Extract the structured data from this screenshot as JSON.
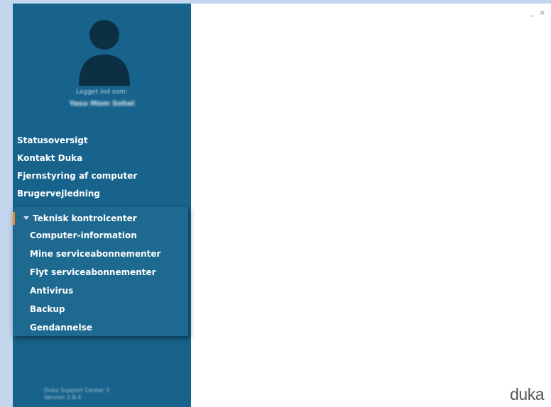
{
  "user": {
    "logged_in_label": "Logget ind som:",
    "name": "Yasu Mom Sohel"
  },
  "nav": {
    "items": [
      {
        "label": "Statusoversigt"
      },
      {
        "label": "Kontakt Duka"
      },
      {
        "label": "Fjernstyring af computer"
      },
      {
        "label": "Brugervejledning"
      }
    ]
  },
  "submenu": {
    "header": "Teknisk kontrolcenter",
    "items": [
      {
        "label": "Computer-information"
      },
      {
        "label": "Mine serviceabonnementer"
      },
      {
        "label": "Flyt serviceabonnementer"
      },
      {
        "label": "Antivirus"
      },
      {
        "label": "Backup"
      },
      {
        "label": "Gendannelse"
      }
    ]
  },
  "footer": {
    "line1": "Duka Support Center 3",
    "line2": "Version 2.8.4"
  },
  "window_controls": {
    "minimize": "_",
    "close": "×"
  },
  "brand": {
    "logo_text": "duka"
  },
  "colors": {
    "sidebar": "#17638c",
    "submenu": "#1d6990",
    "accent": "#f08a1d",
    "avatar": "#0d2f44"
  },
  "icons": {
    "avatar": "user-silhouette-icon",
    "expand": "triangle-down-icon"
  }
}
